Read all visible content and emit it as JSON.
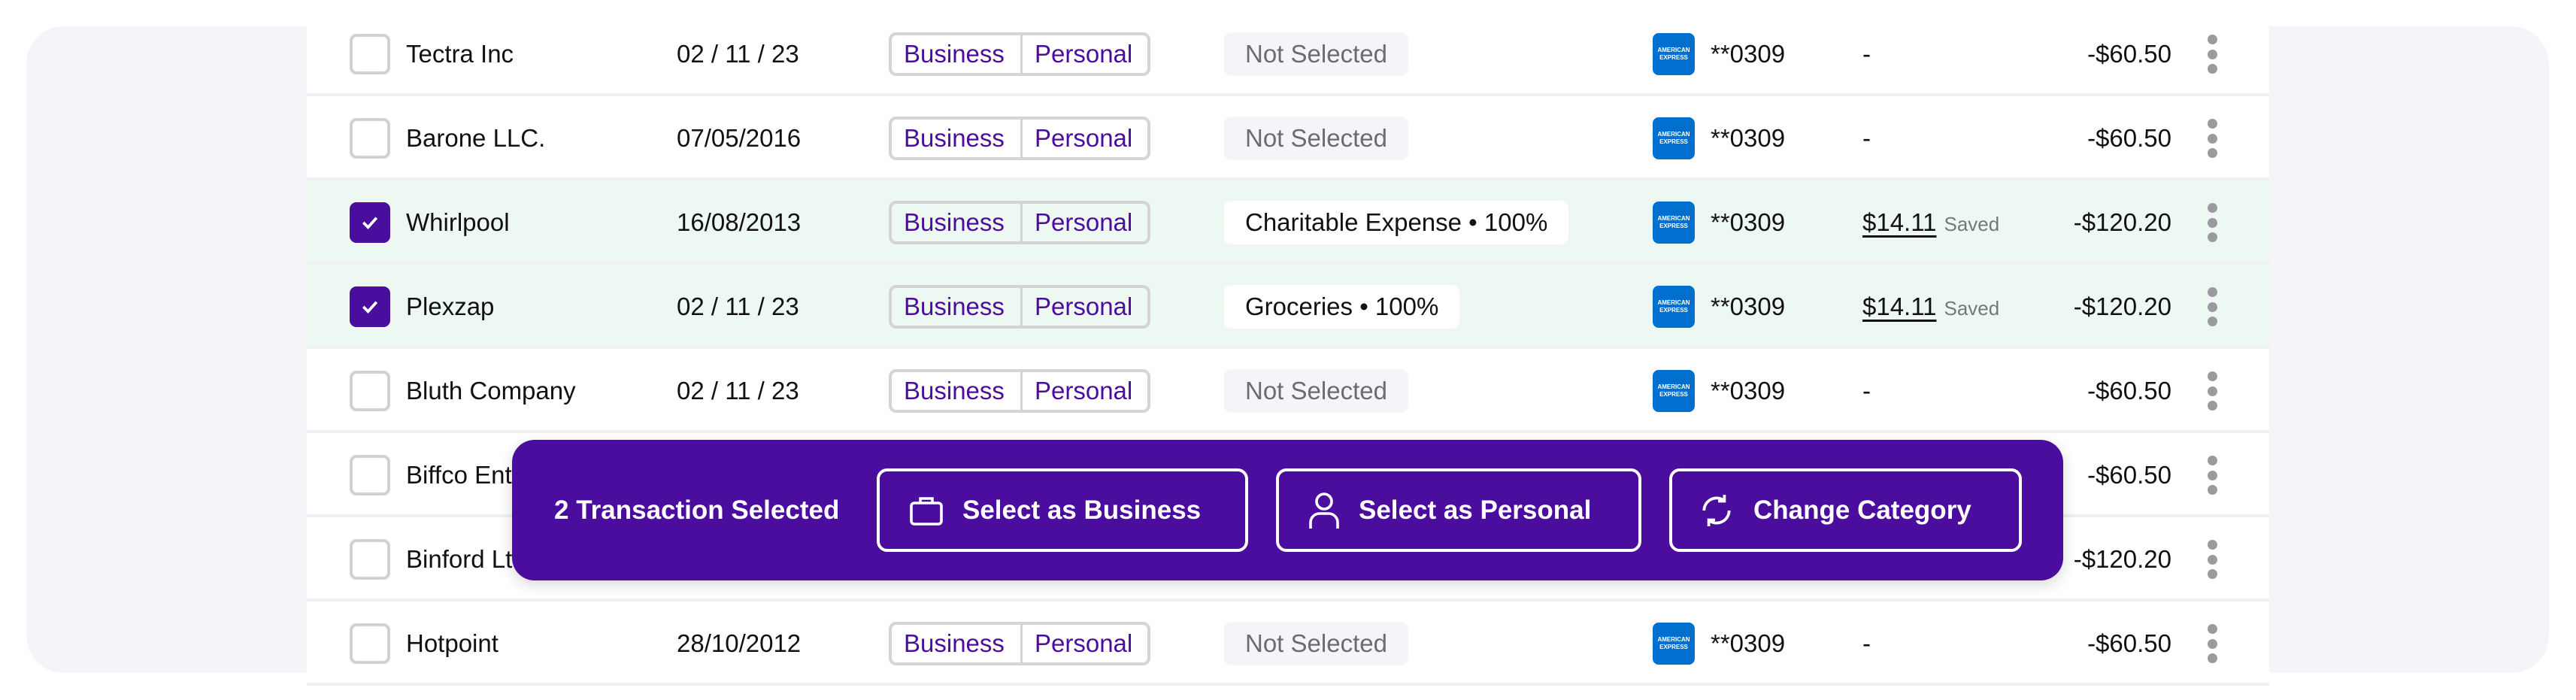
{
  "rows": [
    {
      "name": "Tectra Inc",
      "date": "02 / 11 / 23",
      "business": "Business",
      "personal": "Personal",
      "category": "Not Selected",
      "card": "**0309",
      "saved": "-",
      "saved_label": "",
      "amount": "-$60.50",
      "selected": false
    },
    {
      "name": "Barone LLC.",
      "date": "07/05/2016",
      "business": "Business",
      "personal": "Personal",
      "category": "Not Selected",
      "card": "**0309",
      "saved": "-",
      "saved_label": "",
      "amount": "-$60.50",
      "selected": false
    },
    {
      "name": "Whirlpool",
      "date": "16/08/2013",
      "business": "Business",
      "personal": "Personal",
      "category": "Charitable Expense • 100%",
      "card": "**0309",
      "saved": "$14.11",
      "saved_label": "Saved",
      "amount": "-$120.20",
      "selected": true
    },
    {
      "name": "Plexzap",
      "date": "02 / 11 / 23",
      "business": "Business",
      "personal": "Personal",
      "category": "Groceries • 100%",
      "card": "**0309",
      "saved": "$14.11",
      "saved_label": "Saved",
      "amount": "-$120.20",
      "selected": true
    },
    {
      "name": "Bluth Company",
      "date": "02 / 11 / 23",
      "business": "Business",
      "personal": "Personal",
      "category": "Not Selected",
      "card": "**0309",
      "saved": "-",
      "saved_label": "",
      "amount": "-$60.50",
      "selected": false
    },
    {
      "name": "Biffco Ent",
      "amount": "-$60.50",
      "selected": false
    },
    {
      "name": "Binford Ltd",
      "amount": "-$120.20",
      "selected": false
    },
    {
      "name": "Hotpoint",
      "date": "28/10/2012",
      "business": "Business",
      "personal": "Personal",
      "category": "Not Selected",
      "card": "**0309",
      "saved": "-",
      "saved_label": "",
      "amount": "-$60.50",
      "selected": false
    }
  ],
  "card_logo": "AMERICAN EXPRESS",
  "action_bar": {
    "count_label": "2 Transaction Selected",
    "business_button": "Select as Business",
    "personal_button": "Select as Personal",
    "category_button": "Change Category"
  },
  "colors": {
    "accent": "#4b0d9e",
    "selected_row": "#eef8f2",
    "amex": "#016fd0"
  }
}
